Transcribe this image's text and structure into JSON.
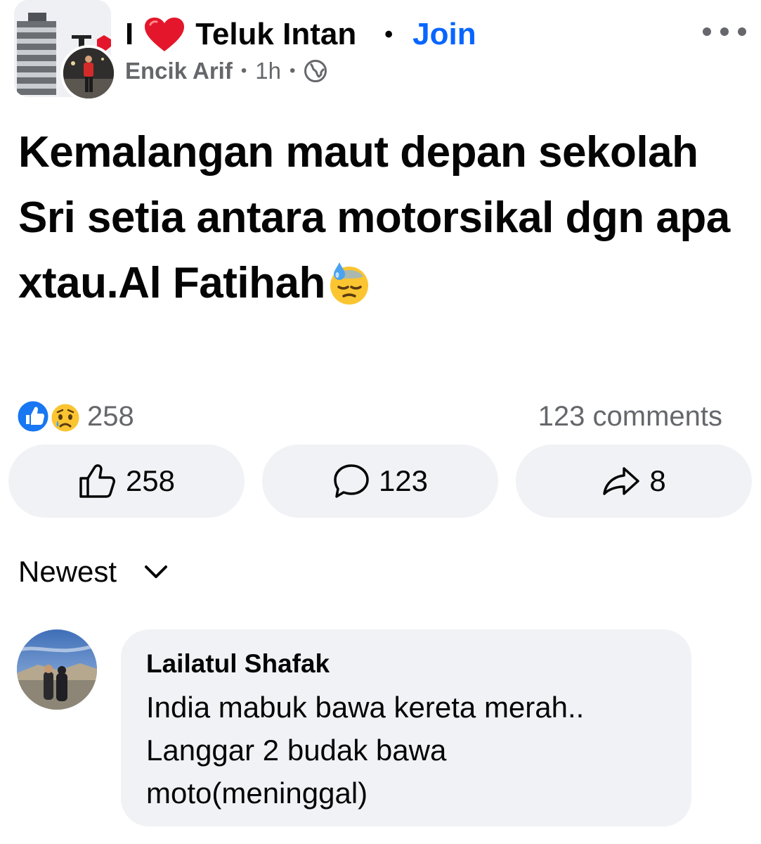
{
  "header": {
    "group_name_prefix": "I",
    "group_name": "Teluk Intan",
    "separator": "•",
    "join_label": "Join",
    "author": "Encik Arif",
    "time": "1h",
    "meta_separator": "•",
    "privacy_icon": "globe-icon",
    "more_icon": "more-horizontal-icon"
  },
  "post": {
    "text": "Kemalangan maut depan sekolah Sri setia antara motorsikal dgn apa xtau.Al Fatihah",
    "emoji": "downcast-face-with-sweat-emoji"
  },
  "reactions": {
    "icons": [
      "like-reaction-icon",
      "sad-reaction-icon"
    ],
    "count": "258",
    "comments_label": "123 comments"
  },
  "actions": {
    "like_count": "258",
    "comment_count": "123",
    "share_count": "8"
  },
  "sort": {
    "label": "Newest"
  },
  "comment": {
    "author": "Lailatul Shafak",
    "text": "India mabuk bawa kereta merah.. Langgar 2 budak bawa moto(meninggal)"
  },
  "colors": {
    "accent": "#0866ff",
    "secondary_text": "#65676b",
    "button_bg": "#f0f2f5",
    "heart": "#e4162b"
  }
}
